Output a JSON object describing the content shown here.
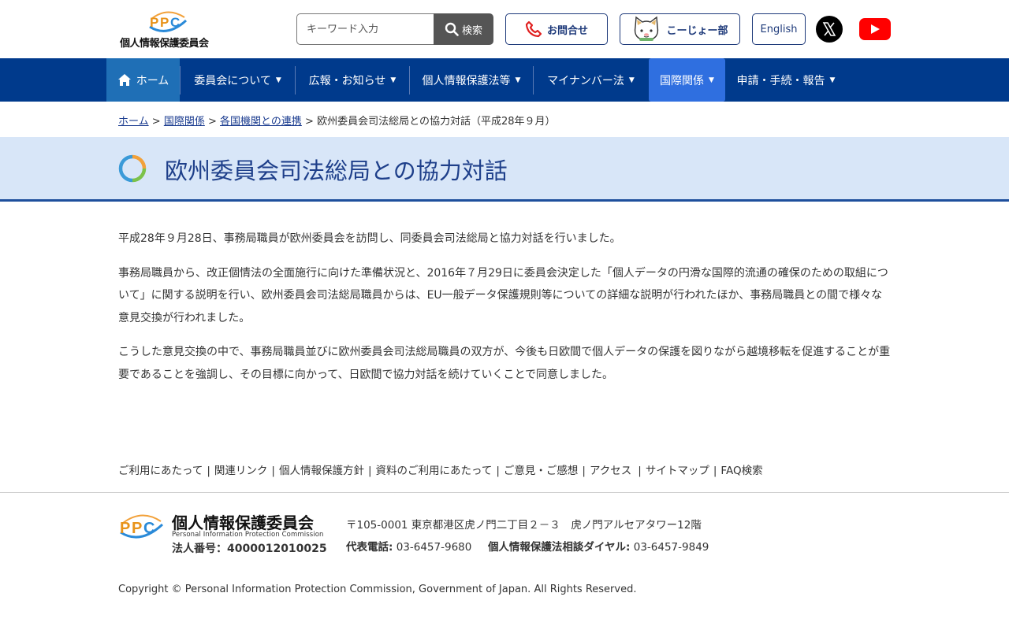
{
  "header": {
    "logo_text": "個人情報保護委員会",
    "logo_mark": "PPC",
    "search_placeholder": "キーワード入力",
    "search_button": "検索",
    "contact_button": "お問合せ",
    "koujoubu_button": "こーじょー部",
    "english_button": "English"
  },
  "nav": {
    "items": [
      {
        "label": "ホーム"
      },
      {
        "label": "委員会について"
      },
      {
        "label": "広報・お知らせ"
      },
      {
        "label": "個人情報保護法等"
      },
      {
        "label": "マイナンバー法"
      },
      {
        "label": "国際関係"
      },
      {
        "label": "申請・手続・報告"
      }
    ],
    "dropdown_glyph": "▼"
  },
  "breadcrumb": {
    "items": [
      "ホーム",
      "国際関係",
      "各国機関との連携",
      "欧州委員会司法総局との協力対話（平成28年９月）"
    ],
    "separator": ">"
  },
  "page": {
    "title": "欧州委員会司法総局との協力対話",
    "paragraphs": [
      "平成28年９月28日、事務局職員が欧州委員会を訪問し、同委員会司法総局と協力対話を行いました。",
      "事務局職員から、改正個情法の全面施行に向けた準備状況と、2016年７月29日に委員会決定した「個人データの円滑な国際的流通の確保のための取組について」に関する説明を行い、欧州委員会司法総局職員からは、EU一般データ保護規則等についての詳細な説明が行われたほか、事務局職員との間で様々な意見交換が行われました。",
      "こうした意見交換の中で、事務局職員並びに欧州委員会司法総局職員の双方が、今後も日欧間で個人データの保護を図りながら越境移転を促進することが重要であることを強調し、その目標に向かって、日欧間で協力対話を続けていくことで同意しました。"
    ]
  },
  "footer": {
    "links": [
      "ご利用にあたって",
      "関連リンク",
      "個人情報保護方針",
      "資料のご利用にあたって",
      "ご意見・ご感想",
      "アクセス",
      "サイトマップ",
      "FAQ検索"
    ],
    "link_separator": "|",
    "logo_mark": "PPC",
    "logo_title": "個人情報保護委員会",
    "logo_en": "Personal Information Protection Commission",
    "corporate_number": "法人番号：4000012010025",
    "address": "〒105-0001 東京都港区虎ノ門二丁目２－３　虎ノ門アルセアタワー12階",
    "tel_label": "代表電話:",
    "tel_value": "03-6457-9680",
    "dial_label": "個人情報保護法相談ダイヤル:",
    "dial_value": "03-6457-9849",
    "copyright": "Copyright © Personal Information Protection Commission, Government of Japan. All Rights Reserved."
  },
  "colors": {
    "nav_bg": "#003a8c",
    "nav_home": "#1f6fb6",
    "nav_active": "#2f6fe0",
    "title_band": "#d8e6f8",
    "link": "#1a3b8f"
  }
}
